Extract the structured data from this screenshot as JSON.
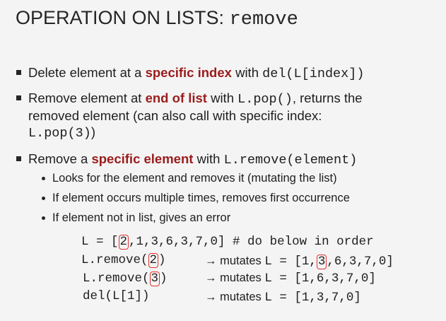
{
  "title": {
    "text": "OPERATION ON LISTS: ",
    "code": "remove"
  },
  "bullets": {
    "b1": {
      "t1": "Delete element at a ",
      "hl": "specific index",
      "t2": " with ",
      "code": "del(L[index])"
    },
    "b2": {
      "t1": "Remove element at ",
      "hl": "end of list",
      "t2": " with ",
      "code": "L.pop()",
      "t3": ", returns the",
      "line2": "removed element (can also call with specific index:",
      "code2": "L.pop(3)",
      "t4": ")"
    },
    "b3": {
      "t1": "Remove a ",
      "hl": "specific element",
      "t2": " with ",
      "code": "L.remove(element)"
    },
    "sub": [
      "Looks for the element and removes it (mutating the list)",
      "If element occurs multiple times, removes first occurrence",
      "If element not in list, gives an error"
    ]
  },
  "code": {
    "l1": {
      "pre": "L = [",
      "boxed": "2",
      "post": ",1,3,6,3,7,0] # do below in order"
    },
    "l2": {
      "pre": "L.remove(",
      "boxed": "2",
      "post": ")",
      "arrow": "→ mutates ",
      "lhs": "L = [1,",
      "boxed2": "3",
      "rest": ",6,3,7,0]"
    },
    "l3": {
      "pre": "L.remove(",
      "boxed": "3",
      "post": ")",
      "arrow": "→ mutates ",
      "rhs": "L = [1,6,3,7,0]"
    },
    "l4": {
      "pre": "del(L[1])",
      "arrow": "→ mutates ",
      "rhs": "L = [1,3,7,0]"
    }
  }
}
